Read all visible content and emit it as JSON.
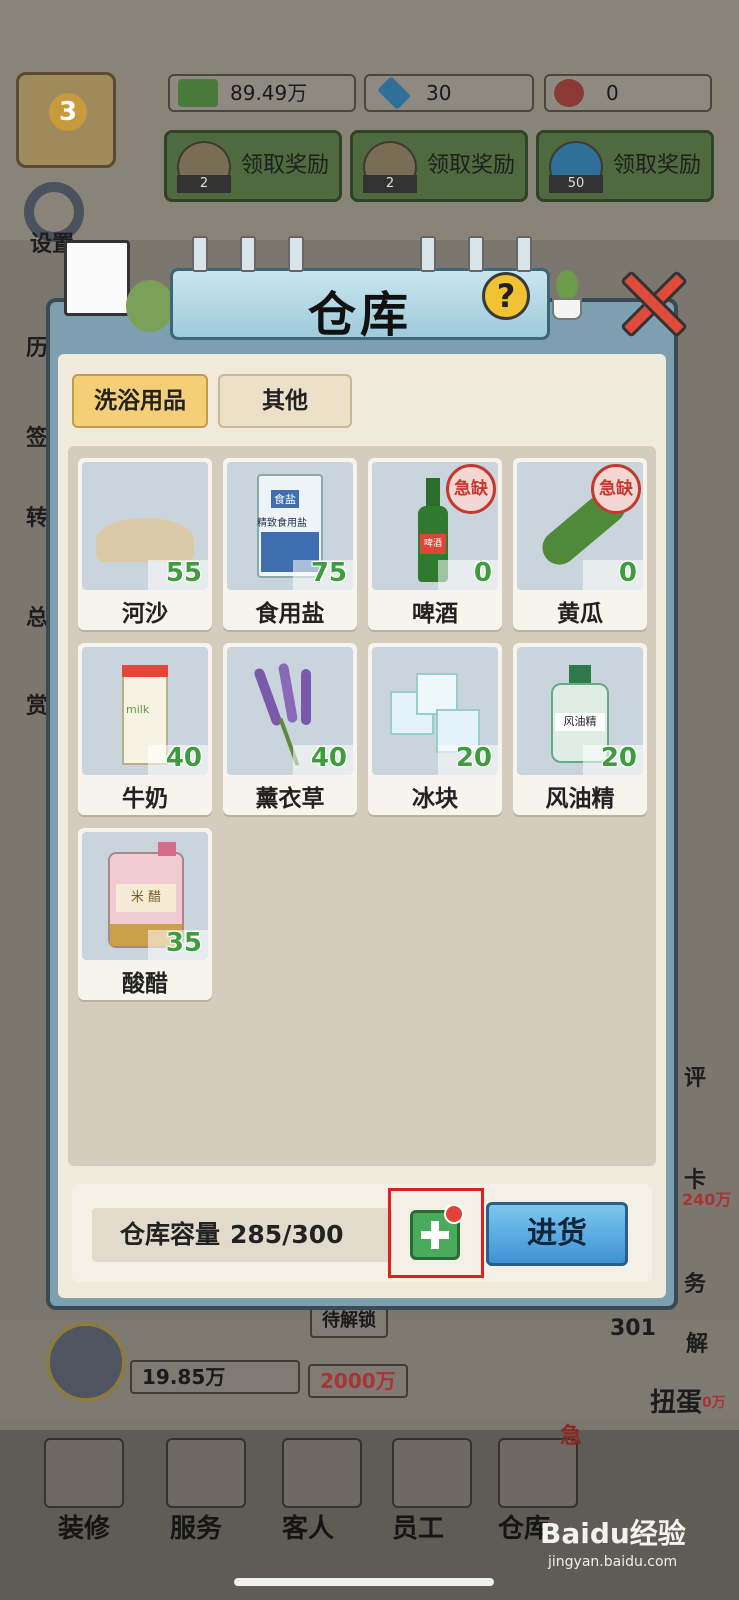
{
  "top_bar": {
    "level": "3",
    "money": "89.49万",
    "diamonds": "30",
    "roses": "0",
    "reward_buttons": [
      {
        "label": "领取奖励",
        "count": "2"
      },
      {
        "label": "领取奖励",
        "count": "2"
      },
      {
        "label": "领取奖励",
        "count": "50"
      }
    ],
    "settings_label": "设置"
  },
  "side_labels": {
    "left": [
      "历",
      "签",
      "转",
      "总",
      "赏"
    ],
    "right": [
      "评",
      "卡",
      "240万",
      "务",
      "301",
      "解",
      "扭蛋",
      "0万"
    ]
  },
  "modal": {
    "title": "仓库",
    "help_symbol": "?",
    "tabs": [
      {
        "label": "洗浴用品",
        "active": true
      },
      {
        "label": "其他",
        "active": false
      }
    ],
    "items": [
      {
        "name": "河沙",
        "qty": "55",
        "urgent": false,
        "icon": "sand-icon"
      },
      {
        "name": "食用盐",
        "qty": "75",
        "urgent": false,
        "icon": "salt-bag-icon",
        "art_text": "食盐",
        "art_sub": "精致食用盐"
      },
      {
        "name": "啤酒",
        "qty": "0",
        "urgent": true,
        "icon": "beer-bottle-icon",
        "art_text": "啤酒"
      },
      {
        "name": "黄瓜",
        "qty": "0",
        "urgent": true,
        "icon": "cucumber-icon"
      },
      {
        "name": "牛奶",
        "qty": "40",
        "urgent": false,
        "icon": "milk-carton-icon",
        "art_text": "milk"
      },
      {
        "name": "薰衣草",
        "qty": "40",
        "urgent": false,
        "icon": "lavender-icon"
      },
      {
        "name": "冰块",
        "qty": "20",
        "urgent": false,
        "icon": "ice-cube-icon"
      },
      {
        "name": "风油精",
        "qty": "20",
        "urgent": false,
        "icon": "oil-bottle-icon",
        "art_text": "风油精"
      },
      {
        "name": "酸醋",
        "qty": "35",
        "urgent": false,
        "icon": "vinegar-jug-icon",
        "art_text": "米 醋"
      }
    ],
    "urgent_label": "急缺",
    "capacity_label": "仓库容量",
    "capacity_value": "285/300",
    "restock_label": "进货"
  },
  "background": {
    "lock_label": "待解锁",
    "income": "19.85万",
    "cost": "2000万",
    "urgent_tag": "急"
  },
  "bottom_nav": [
    {
      "label": "装修"
    },
    {
      "label": "服务"
    },
    {
      "label": "客人"
    },
    {
      "label": "员工"
    },
    {
      "label": "仓库"
    }
  ],
  "watermark": {
    "text": "Baidu经验",
    "sub": "jingyan.baidu.com"
  },
  "colors": {
    "qty_green": "#3f9c3c",
    "urgent_red": "#c2392f",
    "tab_active": "#f5cf78",
    "restock_blue": "#3f93d4",
    "add_green": "#4caa5c",
    "highlight_red": "#e0201c"
  }
}
